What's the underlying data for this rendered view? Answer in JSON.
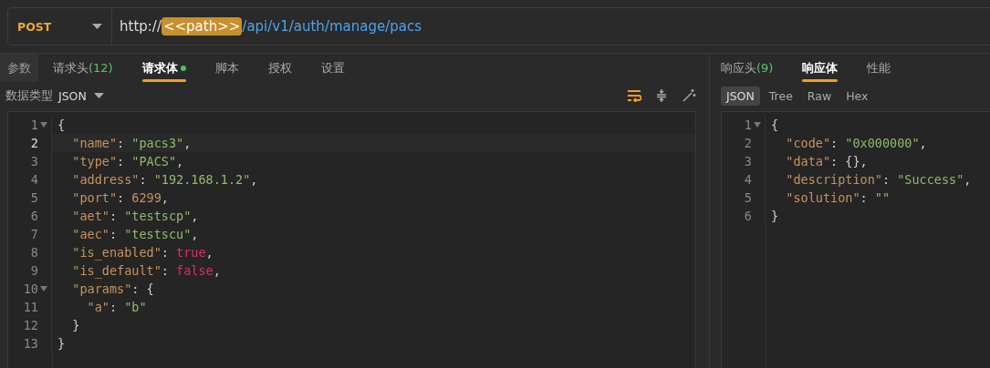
{
  "request_bar": {
    "method": "POST",
    "url_parts": [
      {
        "kind": "plain",
        "text": "http://"
      },
      {
        "kind": "variable",
        "text": "<<path>>"
      },
      {
        "kind": "path",
        "text": "/api/v1/auth/manage/pacs"
      }
    ]
  },
  "request_tabs": [
    {
      "label": "参数",
      "selected": false,
      "hovered": true,
      "dot": false
    },
    {
      "label": "请求头",
      "count": "(12)",
      "selected": false,
      "hovered": false,
      "dot": false
    },
    {
      "label": "请求体",
      "selected": true,
      "hovered": false,
      "dot": true
    },
    {
      "label": "脚本",
      "selected": false,
      "hovered": false,
      "dot": false
    },
    {
      "label": "授权",
      "selected": false,
      "hovered": false,
      "dot": false
    },
    {
      "label": "设置",
      "selected": false,
      "hovered": false,
      "dot": false
    }
  ],
  "body_type": {
    "label": "数据类型",
    "value": "JSON"
  },
  "request_editor": {
    "lines": [
      {
        "number": "1",
        "foldable": true,
        "current": false,
        "tokens": [
          {
            "kind": "punct",
            "text": "{"
          }
        ]
      },
      {
        "number": "2",
        "foldable": false,
        "current": true,
        "tokens": [
          {
            "kind": "key",
            "text": "  \"name\""
          },
          {
            "kind": "punct",
            "text": ": "
          },
          {
            "kind": "string",
            "text": "\"pacs3\""
          },
          {
            "kind": "punct",
            "text": ","
          }
        ]
      },
      {
        "number": "3",
        "foldable": false,
        "current": false,
        "tokens": [
          {
            "kind": "key",
            "text": "  \"type\""
          },
          {
            "kind": "punct",
            "text": ": "
          },
          {
            "kind": "string",
            "text": "\"PACS\""
          },
          {
            "kind": "punct",
            "text": ","
          }
        ]
      },
      {
        "number": "4",
        "foldable": false,
        "current": false,
        "tokens": [
          {
            "kind": "key",
            "text": "  \"address\""
          },
          {
            "kind": "punct",
            "text": ": "
          },
          {
            "kind": "string",
            "text": "\"192.168.1.2\""
          },
          {
            "kind": "punct",
            "text": ","
          }
        ]
      },
      {
        "number": "5",
        "foldable": false,
        "current": false,
        "tokens": [
          {
            "kind": "key",
            "text": "  \"port\""
          },
          {
            "kind": "punct",
            "text": ": "
          },
          {
            "kind": "number",
            "text": "6299"
          },
          {
            "kind": "punct",
            "text": ","
          }
        ]
      },
      {
        "number": "6",
        "foldable": false,
        "current": false,
        "tokens": [
          {
            "kind": "key",
            "text": "  \"aet\""
          },
          {
            "kind": "punct",
            "text": ": "
          },
          {
            "kind": "string",
            "text": "\"testscp\""
          },
          {
            "kind": "punct",
            "text": ","
          }
        ]
      },
      {
        "number": "7",
        "foldable": false,
        "current": false,
        "tokens": [
          {
            "kind": "key",
            "text": "  \"aec\""
          },
          {
            "kind": "punct",
            "text": ": "
          },
          {
            "kind": "string",
            "text": "\"testscu\""
          },
          {
            "kind": "punct",
            "text": ","
          }
        ]
      },
      {
        "number": "8",
        "foldable": false,
        "current": false,
        "tokens": [
          {
            "kind": "key",
            "text": "  \"is_enabled\""
          },
          {
            "kind": "punct",
            "text": ": "
          },
          {
            "kind": "boolean",
            "text": "true"
          },
          {
            "kind": "punct",
            "text": ","
          }
        ]
      },
      {
        "number": "9",
        "foldable": false,
        "current": false,
        "tokens": [
          {
            "kind": "key",
            "text": "  \"is_default\""
          },
          {
            "kind": "punct",
            "text": ": "
          },
          {
            "kind": "boolean",
            "text": "false"
          },
          {
            "kind": "punct",
            "text": ","
          }
        ]
      },
      {
        "number": "10",
        "foldable": true,
        "current": false,
        "tokens": [
          {
            "kind": "key",
            "text": "  \"params\""
          },
          {
            "kind": "punct",
            "text": ": {"
          }
        ]
      },
      {
        "number": "11",
        "foldable": false,
        "current": false,
        "tokens": [
          {
            "kind": "key",
            "text": "    \"a\""
          },
          {
            "kind": "punct",
            "text": ": "
          },
          {
            "kind": "string",
            "text": "\"b\""
          }
        ]
      },
      {
        "number": "12",
        "foldable": false,
        "current": false,
        "tokens": [
          {
            "kind": "punct",
            "text": "  }"
          }
        ]
      },
      {
        "number": "13",
        "foldable": false,
        "current": false,
        "tokens": [
          {
            "kind": "punct",
            "text": "}"
          }
        ]
      }
    ]
  },
  "response_tabs": [
    {
      "label": "响应头",
      "count": "(9)",
      "selected": false
    },
    {
      "label": "响应体",
      "selected": true
    },
    {
      "label": "性能",
      "selected": false
    }
  ],
  "view_modes": [
    {
      "label": "JSON",
      "selected": true
    },
    {
      "label": "Tree",
      "selected": false
    },
    {
      "label": "Raw",
      "selected": false
    },
    {
      "label": "Hex",
      "selected": false
    }
  ],
  "response_editor": {
    "lines": [
      {
        "number": "1",
        "foldable": true,
        "current": false,
        "tokens": [
          {
            "kind": "punct",
            "text": "{"
          }
        ]
      },
      {
        "number": "2",
        "foldable": false,
        "current": false,
        "tokens": [
          {
            "kind": "key",
            "text": "  \"code\""
          },
          {
            "kind": "punct",
            "text": ": "
          },
          {
            "kind": "string",
            "text": "\"0x000000\""
          },
          {
            "kind": "punct",
            "text": ","
          }
        ]
      },
      {
        "number": "3",
        "foldable": false,
        "current": false,
        "tokens": [
          {
            "kind": "key",
            "text": "  \"data\""
          },
          {
            "kind": "punct",
            "text": ": {},"
          }
        ]
      },
      {
        "number": "4",
        "foldable": false,
        "current": false,
        "tokens": [
          {
            "kind": "key",
            "text": "  \"description\""
          },
          {
            "kind": "punct",
            "text": ": "
          },
          {
            "kind": "string",
            "text": "\"Success\""
          },
          {
            "kind": "punct",
            "text": ","
          }
        ]
      },
      {
        "number": "5",
        "foldable": false,
        "current": false,
        "tokens": [
          {
            "kind": "key",
            "text": "  \"solution\""
          },
          {
            "kind": "punct",
            "text": ": "
          },
          {
            "kind": "string",
            "text": "\"\""
          }
        ]
      },
      {
        "number": "6",
        "foldable": false,
        "current": false,
        "tokens": [
          {
            "kind": "punct",
            "text": "}"
          }
        ]
      }
    ]
  }
}
